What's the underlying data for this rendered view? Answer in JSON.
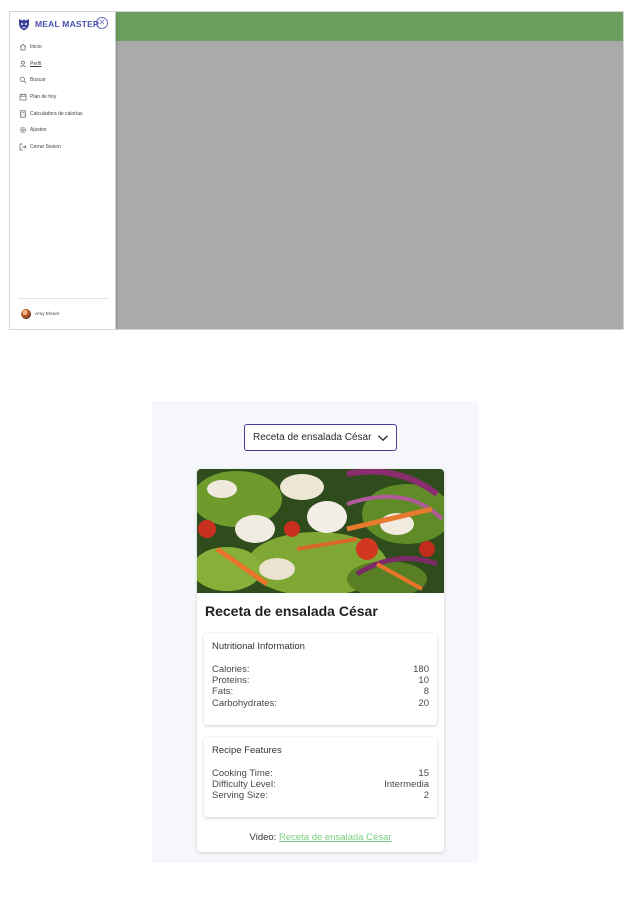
{
  "app": {
    "brand": "MEAL MASTER",
    "nav": [
      {
        "icon": "home-icon",
        "label": "Inicio"
      },
      {
        "icon": "person-icon",
        "label": "Perfil"
      },
      {
        "icon": "search-icon",
        "label": "Buscar"
      },
      {
        "icon": "calendar-icon",
        "label": "Plan de hoy"
      },
      {
        "icon": "calculator-icon",
        "label": "Calculadora de calorías"
      },
      {
        "icon": "gear-icon",
        "label": "Ajustes"
      },
      {
        "icon": "logout-icon",
        "label": "Cerrar Sesion"
      }
    ],
    "user": {
      "name": "Amy Elsner"
    },
    "colors": {
      "topbar": "#6b9e5f",
      "brand": "#4b4fb0",
      "overlay": "#aaaaaa"
    }
  },
  "recipe_view": {
    "select": {
      "value": "Receta de ensalada César"
    },
    "card": {
      "title": "Receta de ensalada César",
      "nutrition": {
        "title": "Nutritional Information",
        "rows": [
          {
            "label": "Calories:",
            "value": "180"
          },
          {
            "label": "Proteins:",
            "value": "10"
          },
          {
            "label": "Fats:",
            "value": "8"
          },
          {
            "label": "Carbohydrates:",
            "value": "20"
          }
        ]
      },
      "features": {
        "title": "Recipe Features",
        "rows": [
          {
            "label": "Cooking Time:",
            "value": "15"
          },
          {
            "label": "Difficulty Level:",
            "value": "Intermedia"
          },
          {
            "label": "Serving Size:",
            "value": "2"
          }
        ]
      },
      "video": {
        "prefix": "Video:",
        "link": "Receta de ensalada César"
      }
    },
    "colors": {
      "select_border": "#4a3a9a",
      "link": "#7bcf7e"
    }
  }
}
